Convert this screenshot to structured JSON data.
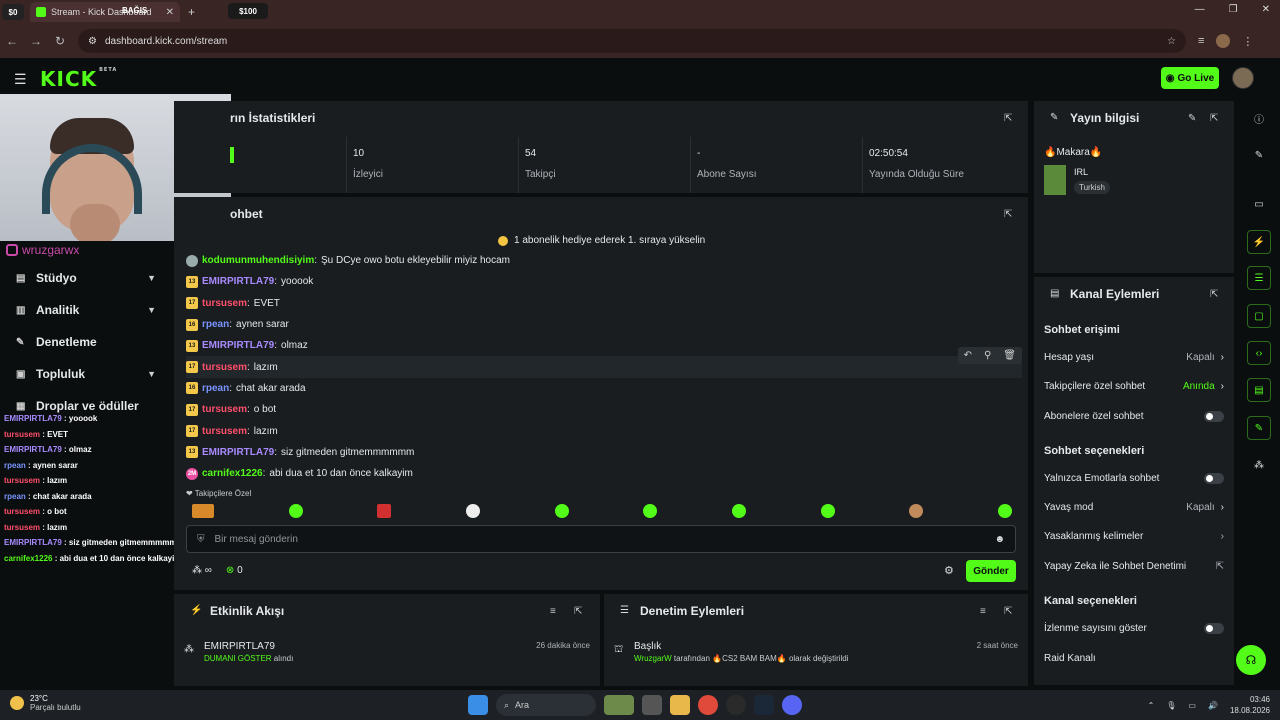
{
  "browser": {
    "tab_title": "Stream - Kick Dashboard",
    "url": "dashboard.kick.com/stream",
    "overlay_left": "$0",
    "overlay_bagis": "BAĞIŞ",
    "overlay_amount": "$100"
  },
  "header": {
    "logo": "KICK",
    "logo_sup": "BETA",
    "go_live": "Go Live"
  },
  "instagram": "wruzgarwx",
  "sidebar": {
    "items": [
      {
        "label": "Stüdyo",
        "has_chevron": true
      },
      {
        "label": "Analitik",
        "has_chevron": true
      },
      {
        "label": "Denetleme",
        "has_chevron": false
      },
      {
        "label": "Topluluk",
        "has_chevron": true
      },
      {
        "label": "Droplar ve ödüller",
        "has_chevron": false
      }
    ]
  },
  "overlay_chat": [
    {
      "user": "EMIRPIRTLA79",
      "color": "#a98bff",
      "text": "yooook"
    },
    {
      "user": "tursusem",
      "color": "#ff4f6b",
      "text": "EVET"
    },
    {
      "user": "EMIRPIRTLA79",
      "color": "#a98bff",
      "text": "olmaz"
    },
    {
      "user": "rpean",
      "color": "#7a95ff",
      "text": "aynen sarar"
    },
    {
      "user": "tursusem",
      "color": "#ff4f6b",
      "text": "lazım"
    },
    {
      "user": "rpean",
      "color": "#7a95ff",
      "text": "chat akar arada"
    },
    {
      "user": "tursusem",
      "color": "#ff4f6b",
      "text": "o bot"
    },
    {
      "user": "tursusem",
      "color": "#ff4f6b",
      "text": "lazım"
    },
    {
      "user": "EMIRPIRTLA79",
      "color": "#a98bff",
      "text": "siz gitmeden gitmemmmmmm"
    },
    {
      "user": "carnifex1226",
      "color": "#53fc18",
      "text": "abi dua et 10 dan önce kalkayim"
    }
  ],
  "stats": {
    "title": "rın İstatistikleri",
    "cells": [
      {
        "value": "10",
        "label": "İzleyici"
      },
      {
        "value": "54",
        "label": "Takipçi"
      },
      {
        "value": "-",
        "label": "Abone Sayısı"
      },
      {
        "value": "02:50:54",
        "label": "Yayında Olduğu Süre"
      }
    ]
  },
  "chat": {
    "title": "ohbet",
    "banner": "1 abonelik hediye ederek 1. sıraya yükselin",
    "messages": [
      {
        "badge": "",
        "badge_type": "gray",
        "user": "kodumunmuhendisiyim",
        "color": "#53fc18",
        "text": "Şu DCye owo botu ekleyebilir miyiz hocam"
      },
      {
        "badge": "13",
        "badge_type": "gold",
        "user": "EMIRPIRTLA79",
        "color": "#a98bff",
        "text": "yooook"
      },
      {
        "badge": "17",
        "badge_type": "gold",
        "user": "tursusem",
        "color": "#ff4f6b",
        "text": "EVET"
      },
      {
        "badge": "16",
        "badge_type": "gold",
        "user": "rpean",
        "color": "#7a95ff",
        "text": "aynen sarar"
      },
      {
        "badge": "13",
        "badge_type": "gold",
        "user": "EMIRPIRTLA79",
        "color": "#a98bff",
        "text": "olmaz"
      },
      {
        "badge": "17",
        "badge_type": "gold",
        "user": "tursusem",
        "color": "#ff4f6b",
        "text": "lazım"
      },
      {
        "badge": "16",
        "badge_type": "gold",
        "user": "rpean",
        "color": "#7a95ff",
        "text": "chat akar arada"
      },
      {
        "badge": "17",
        "badge_type": "gold",
        "user": "tursusem",
        "color": "#ff4f6b",
        "text": "o bot"
      },
      {
        "badge": "17",
        "badge_type": "gold",
        "user": "tursusem",
        "color": "#ff4f6b",
        "text": "lazım"
      },
      {
        "badge": "13",
        "badge_type": "gold",
        "user": "EMIRPIRTLA79",
        "color": "#a98bff",
        "text": "siz gitmeden gitmemmmmmm"
      },
      {
        "badge": "2M",
        "badge_type": "pink",
        "user": "carnifex1226",
        "color": "#53fc18",
        "text": "abi dua et 10 dan önce kalkayim"
      }
    ],
    "follower_label": "❤ Takipçilere Özel",
    "input_placeholder": "Bir mesaj gönderin",
    "footer_infinity": "∞",
    "footer_count": "0",
    "send": "Gönder"
  },
  "events": {
    "title": "Etkinlik Akışı",
    "row_name": "EMIRPIRTLA79",
    "row_sub_green": "DUMANI GÖSTER",
    "row_sub_rest": " alındı",
    "row_time": "26 dakika önce"
  },
  "audit": {
    "title": "Denetim Eylemleri",
    "row_name": "Başlık",
    "row_sub_green": "WruzgarW",
    "row_sub_rest": " tarafından 🔥CS2 BAM BAM🔥 olarak değiştirildi",
    "row_time": "2 saat önce"
  },
  "stream_info": {
    "title": "Yayın bilgisi",
    "stream_title": "🔥Makara🔥",
    "category": "IRL",
    "language": "Turkish"
  },
  "channel_actions": {
    "title": "Kanal Eylemleri",
    "chat_access": "Sohbet erişimi",
    "account_age": {
      "label": "Hesap yaşı",
      "value": "Kapalı"
    },
    "followers_only": {
      "label": "Takipçilere özel sohbet",
      "value": "Anında"
    },
    "subs_only": {
      "label": "Abonelere özel sohbet"
    },
    "chat_options": "Sohbet seçenekleri",
    "emote_only": {
      "label": "Yalnızca Emotlarla sohbet"
    },
    "slow_mode": {
      "label": "Yavaş mod",
      "value": "Kapalı"
    },
    "banned_words": {
      "label": "Yasaklanmış kelimeler"
    },
    "ai_moderation": {
      "label": "Yapay Zeka ile Sohbet Denetimi"
    },
    "channel_options": "Kanal seçenekleri",
    "show_viewers": {
      "label": "İzlenme sayısını göster"
    },
    "raid": {
      "label": "Raid Kanalı"
    }
  },
  "taskbar": {
    "temp": "23°C",
    "weather": "Parçalı bulutlu",
    "search": "Ara",
    "time": "03:46",
    "date": "18.08.2026"
  },
  "colors": {
    "accent": "#53fc18",
    "panel": "#191d20",
    "background": "#0b0e0f"
  }
}
